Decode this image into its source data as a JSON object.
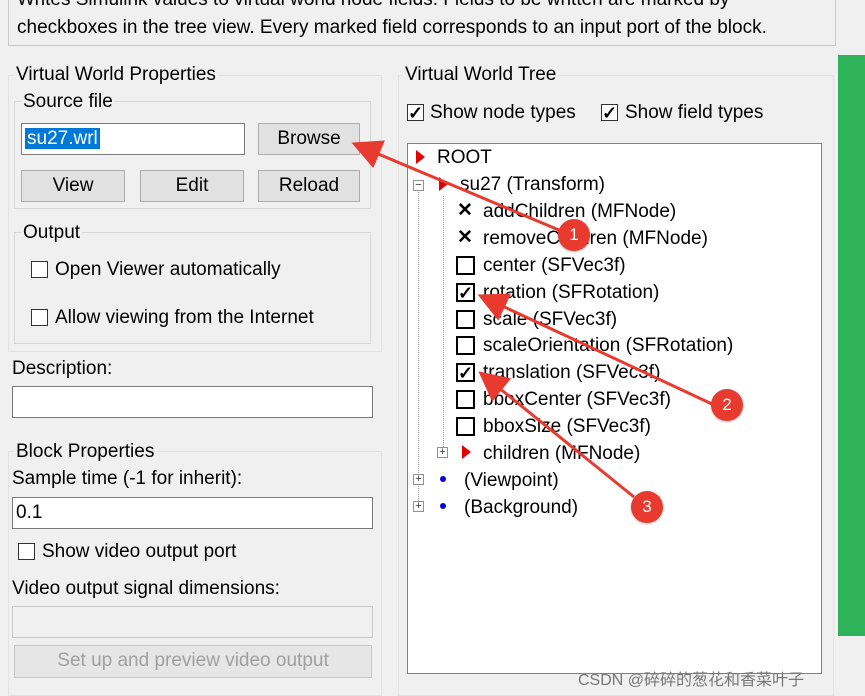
{
  "description": {
    "line1": "Writes Simulink values to virtual world node fields. Fields to be written are marked by",
    "line2": "checkboxes in the tree view. Every marked field corresponds to an input port of the block."
  },
  "vw_properties": {
    "title": "Virtual World Properties",
    "source_file": {
      "title": "Source file",
      "value": "su27.wrl",
      "browse_label": "Browse",
      "view_label": "View",
      "edit_label": "Edit",
      "reload_label": "Reload"
    },
    "output": {
      "title": "Output",
      "open_viewer_label": "Open Viewer automatically",
      "allow_internet_label": "Allow viewing from the Internet",
      "open_viewer_checked": false,
      "allow_internet_checked": false
    },
    "description_label": "Description:",
    "description_value": ""
  },
  "block_properties": {
    "title": "Block Properties",
    "sample_time_label": "Sample time (-1 for inherit):",
    "sample_time_value": "0.1",
    "show_video_label": "Show video output port",
    "show_video_checked": false,
    "video_dims_label": "Video output signal dimensions:",
    "video_dims_value": "",
    "setup_button_label": "Set up and preview video output"
  },
  "tree": {
    "title": "Virtual World Tree",
    "show_node_types_label": "Show node types",
    "show_field_types_label": "Show field types",
    "show_node_types_checked": true,
    "show_field_types_checked": true,
    "root_label": "ROOT",
    "su27_label": "su27 (Transform)",
    "fields": [
      {
        "label": "addChildren (MFNode)",
        "state": "x"
      },
      {
        "label": "removeChildren (MFNode)",
        "state": "x"
      },
      {
        "label": "center (SFVec3f)",
        "state": "unchecked"
      },
      {
        "label": "rotation (SFRotation)",
        "state": "checked"
      },
      {
        "label": "scale (SFVec3f)",
        "state": "unchecked"
      },
      {
        "label": "scaleOrientation (SFRotation)",
        "state": "unchecked"
      },
      {
        "label": "translation (SFVec3f)",
        "state": "checked"
      },
      {
        "label": "bboxCenter (SFVec3f)",
        "state": "unchecked"
      },
      {
        "label": "bboxSize (SFVec3f)",
        "state": "unchecked"
      }
    ],
    "children_label": "children (MFNode)",
    "viewpoint_label": "(Viewpoint)",
    "background_label": "(Background)"
  },
  "annotations": {
    "badge1": "1",
    "badge2": "2",
    "badge3": "3",
    "color": "#e83a2f"
  },
  "watermark": "CSDN @碎碎的葱花和香菜叶子",
  "colors": {
    "selection": "#0078d7",
    "tree_node_triangle": "#e00000",
    "tree_node_dot": "#0000e0",
    "right_strip": "#2fb35a"
  }
}
